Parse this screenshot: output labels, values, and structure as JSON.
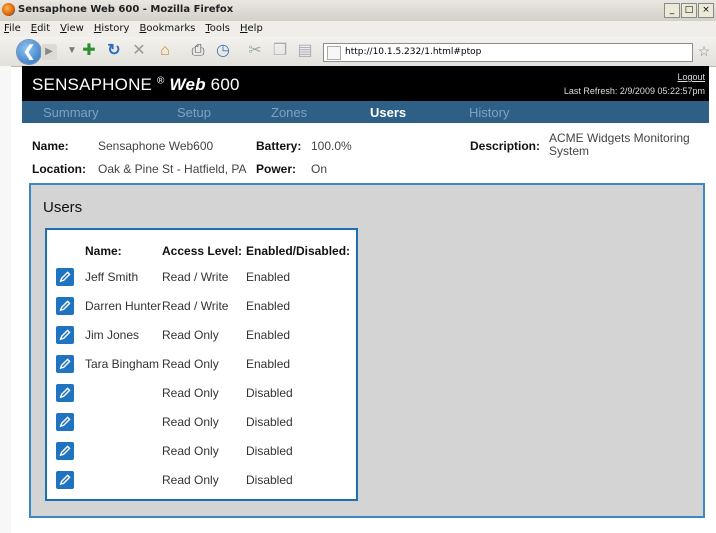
{
  "browser": {
    "title": "Sensaphone Web 600 - Mozilla Firefox",
    "menu": [
      "File",
      "Edit",
      "View",
      "History",
      "Bookmarks",
      "Tools",
      "Help"
    ],
    "url": "http://10.1.5.232/1.html#ptop",
    "window_buttons": [
      "_",
      "□",
      "×"
    ]
  },
  "header": {
    "brand": "SENSAPHONE",
    "registered": "®",
    "product": "Web",
    "model": "600",
    "logout": "Logout",
    "last_refresh": "Last Refresh: 2/9/2009 05:22:57pm"
  },
  "nav": {
    "tabs": [
      {
        "label": "Summary",
        "active": false
      },
      {
        "label": "Setup",
        "active": false
      },
      {
        "label": "Zones",
        "active": false
      },
      {
        "label": "Users",
        "active": true
      },
      {
        "label": "History",
        "active": false
      }
    ]
  },
  "info": {
    "name_label": "Name:",
    "name": "Sensaphone Web600",
    "location_label": "Location:",
    "location": "Oak & Pine St - Hatfield, PA",
    "battery_label": "Battery:",
    "battery": "100.0%",
    "power_label": "Power:",
    "power": "On",
    "description_label": "Description:",
    "description": "ACME Widgets Monitoring System"
  },
  "users": {
    "title": "Users",
    "columns": [
      "Name:",
      "Access Level:",
      "Enabled/Disabled:"
    ],
    "rows": [
      {
        "name": "Jeff Smith",
        "access": "Read / Write",
        "status": "Enabled"
      },
      {
        "name": "Darren Hunter",
        "access": "Read / Write",
        "status": "Enabled"
      },
      {
        "name": "Jim Jones",
        "access": "Read Only",
        "status": "Enabled"
      },
      {
        "name": "Tara Bingham",
        "access": "Read Only",
        "status": "Enabled"
      },
      {
        "name": "",
        "access": "Read Only",
        "status": "Disabled"
      },
      {
        "name": "",
        "access": "Read Only",
        "status": "Disabled"
      },
      {
        "name": "",
        "access": "Read Only",
        "status": "Disabled"
      },
      {
        "name": "",
        "access": "Read Only",
        "status": "Disabled"
      }
    ]
  }
}
